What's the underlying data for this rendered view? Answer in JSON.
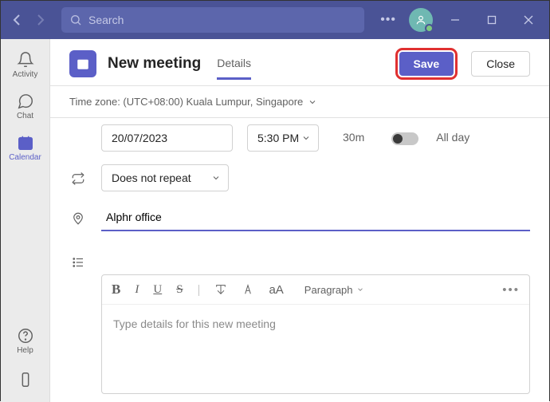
{
  "titlebar": {
    "search_placeholder": "Search",
    "more_label": "..."
  },
  "rail": {
    "activity": "Activity",
    "chat": "Chat",
    "calendar": "Calendar",
    "help": "Help"
  },
  "header": {
    "title": "New meeting",
    "tab_details": "Details",
    "save_label": "Save",
    "close_label": "Close"
  },
  "timezone": {
    "label": "Time zone: (UTC+08:00) Kuala Lumpur, Singapore"
  },
  "form": {
    "date": "20/07/2023",
    "time": "5:30 PM",
    "duration": "30m",
    "allday_label": "All day",
    "repeat": "Does not repeat",
    "location": "Alphr office"
  },
  "editor": {
    "paragraph_label": "Paragraph",
    "placeholder": "Type details for this new meeting",
    "bold": "B",
    "italic": "I",
    "underline": "U",
    "strike": "S",
    "aa": "aA"
  }
}
